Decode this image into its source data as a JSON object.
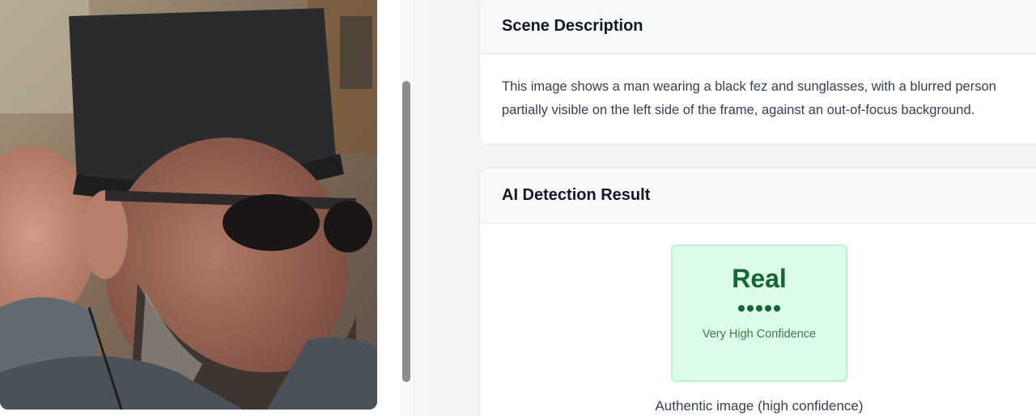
{
  "scene": {
    "title": "Scene Description",
    "text": "This image shows a man wearing a black fez and sunglasses, with a blurred person partially visible on the left side of the frame, against an out-of-focus background."
  },
  "detection": {
    "title": "AI Detection Result",
    "verdict": "Real",
    "confidence_level_dots": 5,
    "confidence_label": "Very High Confidence",
    "summary": "Authentic image (high confidence)",
    "verdict_color": "#166534",
    "box_color": "#dcfce7"
  }
}
